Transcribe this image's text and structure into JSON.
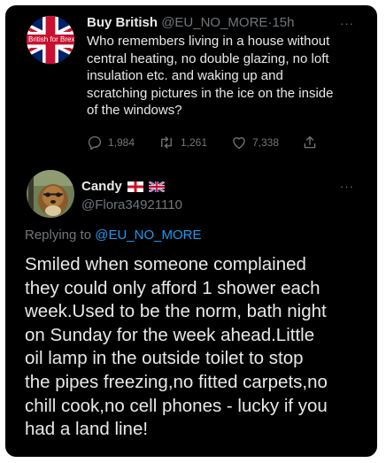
{
  "tweet": {
    "avatar_label": "British for Brexit",
    "display_name": "Buy British",
    "handle": "@EU_NO_MORE",
    "separator": "·",
    "time": "15h",
    "text": "Who remembers living in a house without\ncentral heating, no double glazing, no loft\ninsulation etc. and waking up and\nscratching pictures in the ice on the inside\nof the windows?",
    "replies": "1,984",
    "retweets": "1,261",
    "likes": "7,338",
    "icons": {
      "reply": "reply-icon",
      "retweet": "retweet-icon",
      "like": "heart-icon",
      "share": "share-icon",
      "more": "more-icon"
    }
  },
  "reply": {
    "display_name": "Candy",
    "name_flags": [
      "england-flag-icon",
      "union-jack-icon"
    ],
    "handle": "@Flora34921110",
    "replying_prefix": "Replying to",
    "replying_to": "@EU_NO_MORE",
    "text": "Smiled when someone complained\nthey could only afford 1 shower each\nweek.Used to be the norm, bath night\non Sunday for the week ahead.Little\noil lamp in the outside toilet to stop\nthe pipes freezing,no fitted carpets,no\nchill cook,no cell phones - lucky if you\nhad a land line!"
  },
  "colors": {
    "background": "#000000",
    "text": "#e7e9ea",
    "muted": "#71767b",
    "link": "#1d9bf0"
  }
}
